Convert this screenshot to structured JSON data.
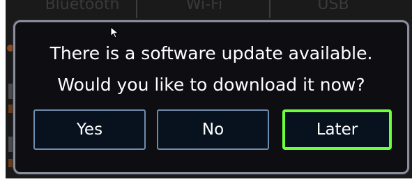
{
  "background_tabs": [
    {
      "label": "Bluetooth"
    },
    {
      "label": "Wi-Fi"
    },
    {
      "label": "USB"
    }
  ],
  "dialog": {
    "message_line_1": "There is a software update available.",
    "message_line_2": "Would you like to download it now?",
    "buttons": {
      "yes_label": "Yes",
      "no_label": "No",
      "later_label": "Later"
    },
    "focused_button": "Later"
  },
  "colors": {
    "dialog_border": "#8a8e9a",
    "button_border": "#6d8cab",
    "focus_highlight": "#6cff3c",
    "background": "#1a1a1a"
  }
}
